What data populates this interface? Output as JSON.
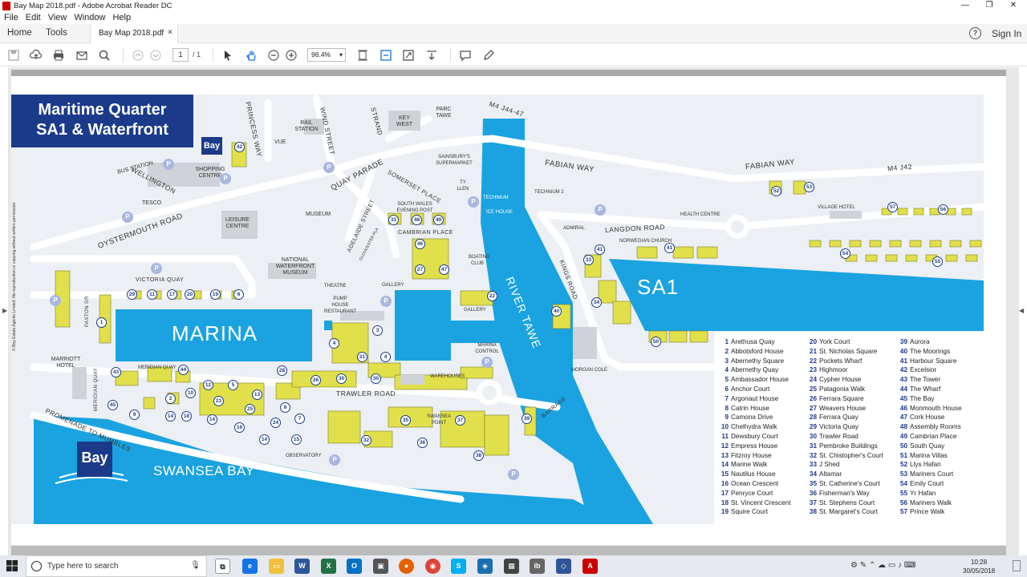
{
  "window": {
    "title": "Bay Map 2018.pdf - Adobe Acrobat Reader DC"
  },
  "menu": [
    "File",
    "Edit",
    "View",
    "Window",
    "Help"
  ],
  "tabs": {
    "home": "Home",
    "tools": "Tools",
    "document": "Bay Map 2018.pdf",
    "close": "×",
    "signin": "Sign In"
  },
  "toolbar": {
    "page_current": "1",
    "page_total": "/ 1",
    "zoom": "96.4%"
  },
  "map": {
    "title_line1": "Maritime Quarter",
    "title_line2": "SA1 & Waterfront",
    "marina": "MARINA",
    "sa1": "SA1",
    "swansea_bay": "SWANSEA BAY",
    "river": "RIVER TAWE",
    "brand": "Bay",
    "copyright": "© Bay Estate Agents Limited. No reproduction or copying without written permission.",
    "roads": {
      "oystermouth": "OYSTERMOUTH ROAD",
      "quay_parade": "QUAY PARADE",
      "fabian_way_1": "FABIAN WAY",
      "fabian_way_2": "FABIAN WAY",
      "m4_1": "M4 J44-47",
      "m4_2": "M4 J42",
      "langdon": "LANGDON ROAD",
      "trawler": "TRAWLER ROAD",
      "victoria_quay": "VICTORIA QUAY",
      "wellington": "WELLINGTON",
      "princess_way": "PRINCESS WAY",
      "wind_street": "WIND STREET",
      "strand": "STRAND",
      "somerset": "SOMERSET PLACE",
      "adelaide": "ADELAIDE STREET",
      "kings_road": "KINGS ROAD",
      "cambrian_place": "CAMBRIAN PLACE",
      "promenade": "PROMENADE TO MUMBLES",
      "barrage": "BARRAGE",
      "paxton": "PAXTON DR",
      "meridian_quay": "MERIDIAN QUAY"
    },
    "places": {
      "bus_station": "BUS STATION",
      "shopping_centre": "SHOPPING CENTRE",
      "tesco": "TESCO",
      "leisure_centre": "LEISURE CENTRE",
      "vue": "VUE",
      "rail_station": "RAIL STATION",
      "key_west": "KEY WEST",
      "parc_tawe": "PARC TAWE",
      "sainsburys": "SAINSBURY'S SUPERMARKET",
      "museum": "MUSEUM",
      "nwm": "NATIONAL WATERFRONT MUSEUM",
      "south_wales_evening_post": "SOUTH WALES EVENING POST",
      "ty_llen": "TY LLEN",
      "technium": "TECHNIUM",
      "technium2": "TECHNIUM 2",
      "ice_house": "ICE HOUSE",
      "admiral": "ADMIRAL",
      "health_centre": "HEALTH CENTRE",
      "village_hotel": "VILLAGE HOTEL",
      "norwegian_church": "NORWEGIAN CHURCH",
      "boating_club": "BOATING CLUB",
      "theatre": "THEATRE",
      "gallery1": "GALLERY",
      "gallery2": "GALLERY",
      "pump_house": "PUMP HOUSE RESTAURANT",
      "marina_control": "MARINA CONTROL",
      "morgan_cole": "MORGAN COLE",
      "warehouses": "WAREHOUSES",
      "marriott": "MARRIOTT HOTEL",
      "observatory": "OBSERVATORY",
      "swansea_point": "SWANSEA POINT",
      "meridian_quay_lbl": "MERIDIAN QUAY",
      "gloucester": "GLOUCESTER PLA"
    },
    "legend": [
      "Arethusa Quay",
      "Abbotsford House",
      "Abernethy Square",
      "Abernethy Quay",
      "Ambassador House",
      "Anchor Court",
      "Argonaut House",
      "Catrin House",
      "Camona Drive",
      "Chelhydra Walk",
      "Dewsbury Court",
      "Empress House",
      "Fitzroy House",
      "Marine Walk",
      "Nautilus House",
      "Ocean Crescent",
      "Penryce Court",
      "St. Vincent Crescent",
      "Squire Court",
      "York Court",
      "St. Nicholas Square",
      "Pockets Wharf",
      "Highmoor",
      "Cypher House",
      "Patagonia Walk",
      "Ferrara Square",
      "Weavers House",
      "Ferrara Quay",
      "Victoria Quay",
      "Trawler Road",
      "Pembroke Buildings",
      "St. Chistopher's Court",
      "J Shed",
      "Altamar",
      "St. Catherine's Court",
      "Fisherman's Way",
      "St. Stephens Court",
      "St. Margaret's Court",
      "Aurora",
      "The Moorings",
      "Harbour Square",
      "Excelsior",
      "The Tower",
      "The Wharf",
      "The Bay",
      "Monmouth House",
      "Cork House",
      "Assembly Rooms",
      "Cambrian Place",
      "South Quay",
      "Marina Villas",
      "Llys Hafan",
      "Mariners Court",
      "Emily Court",
      "Yr Hafan",
      "Mariners Walk",
      "Prince Walk"
    ]
  },
  "taskbar": {
    "search_placeholder": "Type here to search",
    "time": "10:28",
    "date": "30/05/2018"
  },
  "colors": {
    "navy": "#1b3a8a",
    "water": "#1aa3e0",
    "building": "#e2e04a",
    "road": "#ffffff",
    "land": "#eceff3"
  },
  "icons": [
    "pdf-icon",
    "save-icon",
    "upload-icon",
    "print-icon",
    "email-icon",
    "search-icon",
    "prev-page-icon",
    "next-page-icon",
    "select-icon",
    "hand-icon",
    "zoom-out-icon",
    "zoom-in-icon",
    "help-icon",
    "comment-icon",
    "pen-icon"
  ]
}
